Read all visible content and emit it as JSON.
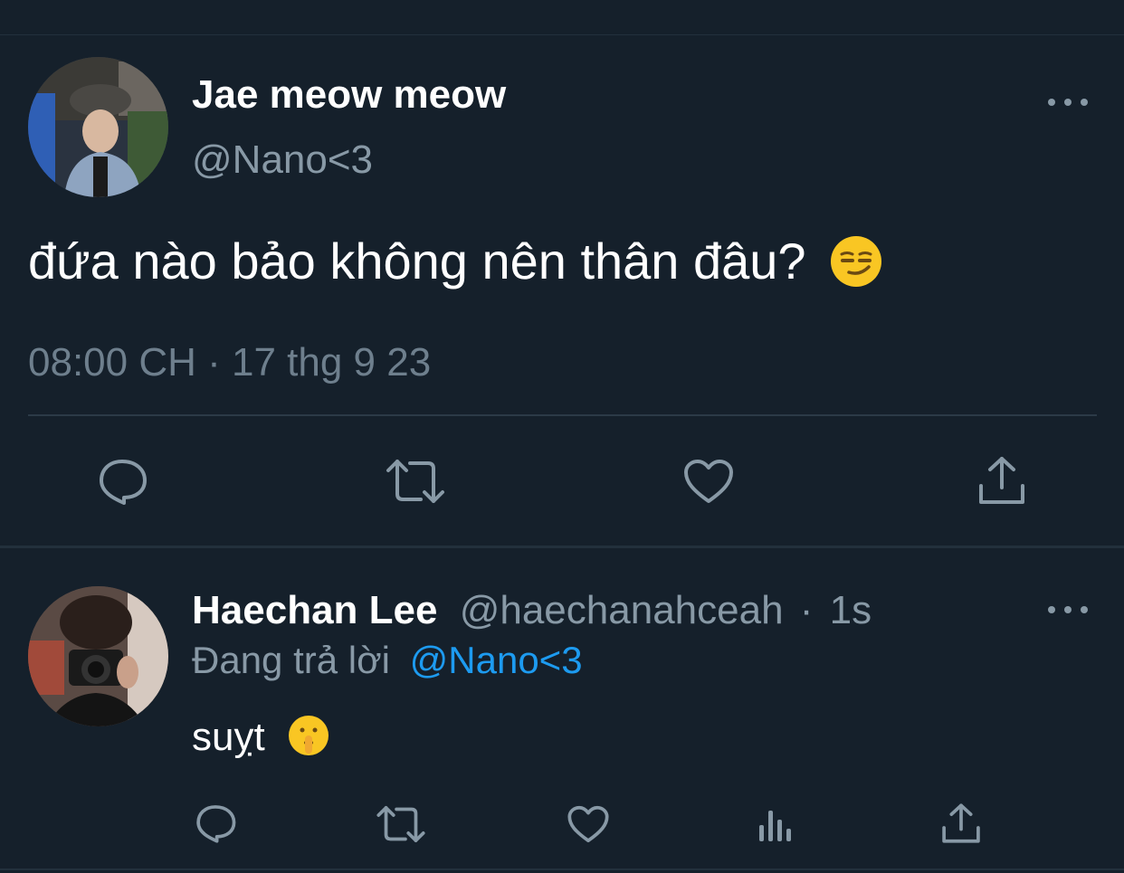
{
  "main_tweet": {
    "display_name": "Jae meow meow",
    "handle": "@Nano<3",
    "text": "đứa nào bảo không nên thân đâu?",
    "emoji": "smirking-face",
    "timestamp": "08:00 CH · 17 thg 9 23",
    "actions": [
      "reply",
      "retweet",
      "like",
      "share"
    ]
  },
  "reply_tweet": {
    "display_name": "Haechan Lee",
    "handle": "@haechanahceah",
    "separator": "·",
    "time": "1s",
    "replying_prefix": "Đang trả lời",
    "replying_to": "@Nano<3",
    "text": "suỵt",
    "emoji": "shushing-face",
    "actions": [
      "reply",
      "retweet",
      "like",
      "analytics",
      "share"
    ]
  },
  "colors": {
    "background": "#15202b",
    "text_primary": "#ffffff",
    "text_secondary": "#8899a6",
    "mention": "#1d9bf0",
    "divider": "#2c3a47"
  }
}
